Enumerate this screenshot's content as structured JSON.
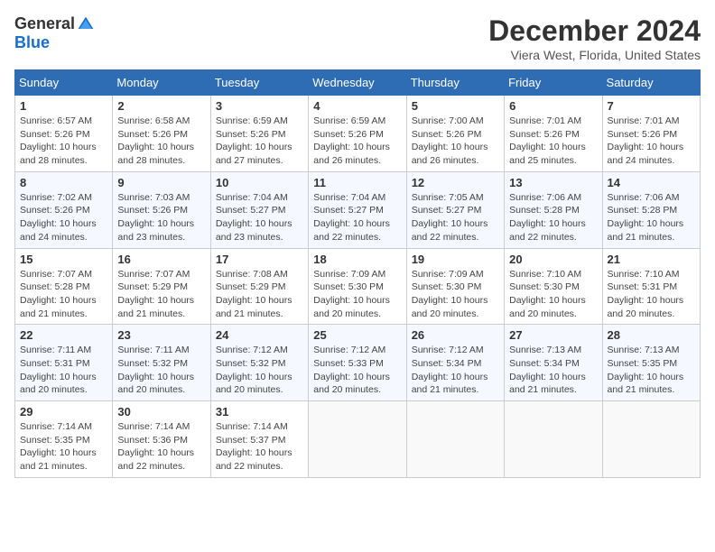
{
  "logo": {
    "general": "General",
    "blue": "Blue"
  },
  "title": "December 2024",
  "location": "Viera West, Florida, United States",
  "weekdays": [
    "Sunday",
    "Monday",
    "Tuesday",
    "Wednesday",
    "Thursday",
    "Friday",
    "Saturday"
  ],
  "weeks": [
    [
      {
        "day": "1",
        "info": "Sunrise: 6:57 AM\nSunset: 5:26 PM\nDaylight: 10 hours\nand 28 minutes."
      },
      {
        "day": "2",
        "info": "Sunrise: 6:58 AM\nSunset: 5:26 PM\nDaylight: 10 hours\nand 28 minutes."
      },
      {
        "day": "3",
        "info": "Sunrise: 6:59 AM\nSunset: 5:26 PM\nDaylight: 10 hours\nand 27 minutes."
      },
      {
        "day": "4",
        "info": "Sunrise: 6:59 AM\nSunset: 5:26 PM\nDaylight: 10 hours\nand 26 minutes."
      },
      {
        "day": "5",
        "info": "Sunrise: 7:00 AM\nSunset: 5:26 PM\nDaylight: 10 hours\nand 26 minutes."
      },
      {
        "day": "6",
        "info": "Sunrise: 7:01 AM\nSunset: 5:26 PM\nDaylight: 10 hours\nand 25 minutes."
      },
      {
        "day": "7",
        "info": "Sunrise: 7:01 AM\nSunset: 5:26 PM\nDaylight: 10 hours\nand 24 minutes."
      }
    ],
    [
      {
        "day": "8",
        "info": "Sunrise: 7:02 AM\nSunset: 5:26 PM\nDaylight: 10 hours\nand 24 minutes."
      },
      {
        "day": "9",
        "info": "Sunrise: 7:03 AM\nSunset: 5:26 PM\nDaylight: 10 hours\nand 23 minutes."
      },
      {
        "day": "10",
        "info": "Sunrise: 7:04 AM\nSunset: 5:27 PM\nDaylight: 10 hours\nand 23 minutes."
      },
      {
        "day": "11",
        "info": "Sunrise: 7:04 AM\nSunset: 5:27 PM\nDaylight: 10 hours\nand 22 minutes."
      },
      {
        "day": "12",
        "info": "Sunrise: 7:05 AM\nSunset: 5:27 PM\nDaylight: 10 hours\nand 22 minutes."
      },
      {
        "day": "13",
        "info": "Sunrise: 7:06 AM\nSunset: 5:28 PM\nDaylight: 10 hours\nand 22 minutes."
      },
      {
        "day": "14",
        "info": "Sunrise: 7:06 AM\nSunset: 5:28 PM\nDaylight: 10 hours\nand 21 minutes."
      }
    ],
    [
      {
        "day": "15",
        "info": "Sunrise: 7:07 AM\nSunset: 5:28 PM\nDaylight: 10 hours\nand 21 minutes."
      },
      {
        "day": "16",
        "info": "Sunrise: 7:07 AM\nSunset: 5:29 PM\nDaylight: 10 hours\nand 21 minutes."
      },
      {
        "day": "17",
        "info": "Sunrise: 7:08 AM\nSunset: 5:29 PM\nDaylight: 10 hours\nand 21 minutes."
      },
      {
        "day": "18",
        "info": "Sunrise: 7:09 AM\nSunset: 5:30 PM\nDaylight: 10 hours\nand 20 minutes."
      },
      {
        "day": "19",
        "info": "Sunrise: 7:09 AM\nSunset: 5:30 PM\nDaylight: 10 hours\nand 20 minutes."
      },
      {
        "day": "20",
        "info": "Sunrise: 7:10 AM\nSunset: 5:30 PM\nDaylight: 10 hours\nand 20 minutes."
      },
      {
        "day": "21",
        "info": "Sunrise: 7:10 AM\nSunset: 5:31 PM\nDaylight: 10 hours\nand 20 minutes."
      }
    ],
    [
      {
        "day": "22",
        "info": "Sunrise: 7:11 AM\nSunset: 5:31 PM\nDaylight: 10 hours\nand 20 minutes."
      },
      {
        "day": "23",
        "info": "Sunrise: 7:11 AM\nSunset: 5:32 PM\nDaylight: 10 hours\nand 20 minutes."
      },
      {
        "day": "24",
        "info": "Sunrise: 7:12 AM\nSunset: 5:32 PM\nDaylight: 10 hours\nand 20 minutes."
      },
      {
        "day": "25",
        "info": "Sunrise: 7:12 AM\nSunset: 5:33 PM\nDaylight: 10 hours\nand 20 minutes."
      },
      {
        "day": "26",
        "info": "Sunrise: 7:12 AM\nSunset: 5:34 PM\nDaylight: 10 hours\nand 21 minutes."
      },
      {
        "day": "27",
        "info": "Sunrise: 7:13 AM\nSunset: 5:34 PM\nDaylight: 10 hours\nand 21 minutes."
      },
      {
        "day": "28",
        "info": "Sunrise: 7:13 AM\nSunset: 5:35 PM\nDaylight: 10 hours\nand 21 minutes."
      }
    ],
    [
      {
        "day": "29",
        "info": "Sunrise: 7:14 AM\nSunset: 5:35 PM\nDaylight: 10 hours\nand 21 minutes."
      },
      {
        "day": "30",
        "info": "Sunrise: 7:14 AM\nSunset: 5:36 PM\nDaylight: 10 hours\nand 22 minutes."
      },
      {
        "day": "31",
        "info": "Sunrise: 7:14 AM\nSunset: 5:37 PM\nDaylight: 10 hours\nand 22 minutes."
      },
      null,
      null,
      null,
      null
    ]
  ]
}
